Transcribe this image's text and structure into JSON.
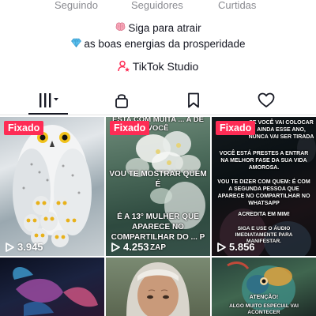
{
  "profile_stats": {
    "following_label": "Seguindo",
    "followers_label": "Seguidores",
    "likes_label": "Curtidas"
  },
  "bio": {
    "line1": "Siga para atrair",
    "line2": "as boas energias da prosperidade",
    "line1_icon": "brain-icon",
    "line2_icon": "gem-icon"
  },
  "studio_link": {
    "label": "TikTok Studio",
    "icon": "studio-person-icon"
  },
  "tabs": [
    {
      "name": "videos",
      "icon": "grid-icon",
      "active": true
    },
    {
      "name": "private",
      "icon": "lock-icon",
      "active": false
    },
    {
      "name": "favorites",
      "icon": "bookmark-icon",
      "active": false
    },
    {
      "name": "liked",
      "icon": "heart-icon",
      "active": false
    }
  ],
  "videos": [
    {
      "pinned_label": "Fixado",
      "views": "3.945",
      "caption": ""
    },
    {
      "pinned_label": "Fixado",
      "views": "4.253",
      "text_top": "ESTA COM MUITA ... A DE VOCÊ",
      "text_mid": "VOU TE MOSTRAR QUEM É",
      "text_bottom": "É A 13° MULHER QUE APARECE NO COMPARTILHAR DO ... P ZAP"
    },
    {
      "pinned_label": "Fixado",
      "views": "5.856",
      "text_1": "SE VOCÊ VAI COLOCAR AINDA ESSE ANO, NUNCA VAI SER TIRADA",
      "text_2": "VOCÊ ESTÁ PRESTES A ENTRAR NA MELHOR FASE DA SUA VIDA AMOROSA.",
      "text_3": "VOU TE DIZER COM QUEM: É COM A SEGUNDA PESSOA QUE APARECE NO COMPARTILHAR NO WHATSAPP",
      "text_4": "ACREDITA EM MIM!",
      "text_5": "SIGA E USE O ÁUDIO IMEDIATAMENTE PARA MANIFESTAR."
    },
    {
      "views": ""
    },
    {
      "views": ""
    },
    {
      "views": "",
      "text_1": "ATENÇÃO!",
      "text_2": "ALGO MUITO ESPECIAL VAI ACONTECER"
    }
  ],
  "colors": {
    "accent": "#fe2c55",
    "text_primary": "#161823",
    "text_secondary": "#8a8b91"
  }
}
